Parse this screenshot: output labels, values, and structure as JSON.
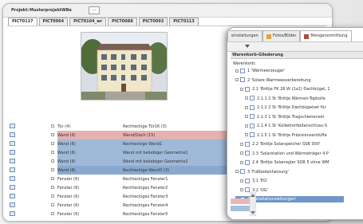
{
  "main_window": {
    "project_label": "Projekt:",
    "project_name": "MusterprojektWBe",
    "project_button_label": "...",
    "image_tabs": [
      {
        "label": "PICT0117",
        "active": true
      },
      {
        "label": "PICT0064",
        "active": false
      },
      {
        "label": "PICT0104_wr",
        "active": false
      },
      {
        "label": "PICT0088",
        "active": false
      },
      {
        "label": "PICT0093",
        "active": false
      },
      {
        "label": "PICT0113",
        "active": false
      }
    ],
    "element_rows": [
      {
        "type": "Tür (4)",
        "desc": "Rechteckige Tür16 (3)",
        "highlight": "none"
      },
      {
        "type": "Wand (6)",
        "desc": "Wand/Dach (15)",
        "highlight": "pink"
      },
      {
        "type": "Wand (6)",
        "desc": "Rechteckige Wand1",
        "highlight": "blue"
      },
      {
        "type": "Wand (6)",
        "desc": "Wand mit beliebiger Geometrie1",
        "highlight": "blue"
      },
      {
        "type": "Wand (6)",
        "desc": "Wand mit beliebiger Geometrie2",
        "highlight": "blue"
      },
      {
        "type": "Wand (6)",
        "desc": "Rechteckige Wand3 (3)",
        "highlight": "darkblue"
      },
      {
        "type": "Fenster (6)",
        "desc": "Rechteckiges Fenster1",
        "highlight": "none"
      },
      {
        "type": "Fenster (6)",
        "desc": "Rechteckiges Fenster2",
        "highlight": "none"
      },
      {
        "type": "Fenster (6)",
        "desc": "Rechteckiges Fenster3",
        "highlight": "none"
      },
      {
        "type": "Fenster (6)",
        "desc": "Rechteckiges Fenster4",
        "highlight": "none"
      },
      {
        "type": "Fenster (6)",
        "desc": "Rechteckiges Fenster5",
        "highlight": "none"
      }
    ]
  },
  "overlay_window": {
    "tabs": [
      {
        "label": "einstellungen",
        "icon": "settings-icon",
        "active": false
      },
      {
        "label": "Fotos/Bilder",
        "icon": "photo-icon",
        "active": false
      },
      {
        "label": "Mengenermittlung",
        "icon": "basket-icon",
        "active": true
      }
    ],
    "basket_header": "Warenkorb-Gliederung",
    "basket_root": "Warenkorb:",
    "tree": [
      {
        "label": "1 'Wärmeerzeuger'",
        "level": 1,
        "selected": false
      },
      {
        "label": "2 'Solare Warmwasserbereitung",
        "level": 1,
        "selected": false
      },
      {
        "label": "2.1 'Brötje  FK 26 W (1x2) Dachbügel, 1",
        "level": 2,
        "selected": false
      },
      {
        "label": "2.1.1  2 St 'Brötje Wärmen-Topkolle",
        "level": 3,
        "selected": false
      },
      {
        "label": "2.1.2  2 St 'Brötje Dachbügelset für",
        "level": 3,
        "selected": false
      },
      {
        "label": "2.1.3  1 St 'Brötje Tragschienenset",
        "level": 3,
        "selected": false
      },
      {
        "label": "2.1.4  1 St 'Kollektorfeldanschluss-S",
        "level": 3,
        "selected": false
      },
      {
        "label": "2.1.5  1 St 'Brötje Präzisionsentlüfte",
        "level": 3,
        "selected": false
      },
      {
        "label": "2.2 'Brötje Solarspeicher SSB 300'",
        "level": 2,
        "selected": false
      },
      {
        "label": "2.3 'Solarstation und Wärmeträger 4 P",
        "level": 2,
        "selected": false
      },
      {
        "label": "2.4 'Brötje Solarregler SOR 5 ohne WM",
        "level": 2,
        "selected": false
      },
      {
        "label": "3 'Fußbodenheizung'",
        "level": 1,
        "selected": false
      },
      {
        "label": "3.1 'EG'",
        "level": 2,
        "selected": false
      },
      {
        "label": "3.2 'OG'",
        "level": 2,
        "selected": false
      },
      {
        "label": "4 'Installationsleitungen'",
        "level": 1,
        "selected": true
      }
    ]
  },
  "colors": {
    "selection_pink": "#e6b1b1",
    "selection_blue": "#9fb9d8",
    "tree_selected": "#6f96c9"
  }
}
